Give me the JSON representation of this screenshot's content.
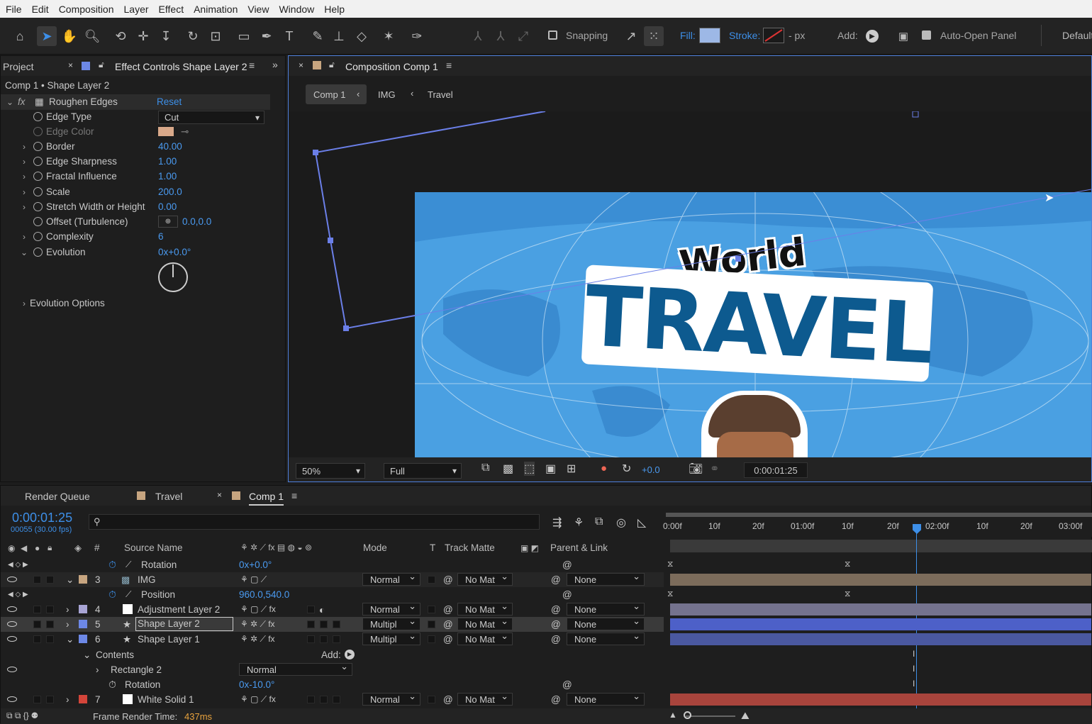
{
  "menu": [
    "File",
    "Edit",
    "Composition",
    "Layer",
    "Effect",
    "Animation",
    "View",
    "Window",
    "Help"
  ],
  "toolbar": {
    "snapping": "Snapping",
    "fill": "Fill:",
    "stroke": "Stroke:",
    "stroke_px": "- px",
    "add": "Add:",
    "auto_open": "Auto-Open Panel",
    "workspace": "Default"
  },
  "project_panel": {
    "project_tab": "Project",
    "effect_tab": "Effect Controls Shape Layer 2",
    "breadcrumb": "Comp 1 • Shape Layer 2",
    "effect_name": "Roughen Edges",
    "reset": "Reset",
    "props": [
      {
        "name": "Edge Type",
        "value": "Cut"
      },
      {
        "name": "Edge Color",
        "value": ""
      },
      {
        "name": "Border",
        "value": "40.00"
      },
      {
        "name": "Edge Sharpness",
        "value": "1.00"
      },
      {
        "name": "Fractal Influence",
        "value": "1.00"
      },
      {
        "name": "Scale",
        "value": "200.0"
      },
      {
        "name": "Stretch Width or Height",
        "value": "0.00"
      },
      {
        "name": "Offset (Turbulence)",
        "value": "0.0,0.0"
      },
      {
        "name": "Complexity",
        "value": "6"
      },
      {
        "name": "Evolution",
        "value": "0x+0.0°"
      }
    ],
    "evolution_options": "Evolution Options",
    "edge_color": "#d9a98a"
  },
  "comp_panel": {
    "tab": "Composition Comp 1",
    "crumbs": [
      "Comp 1",
      "IMG",
      "Travel"
    ],
    "zoom": "50%",
    "resolution": "Full",
    "exposure": "+0.0",
    "timecode": "0:00:01:25",
    "title_top": "World",
    "title_main": "TRAVEL"
  },
  "timeline": {
    "tabs": [
      "Render Queue",
      "Travel",
      "Comp 1"
    ],
    "timecode": "0:00:01:25",
    "fps": "00055 (30.00 fps)",
    "search_placeholder": "",
    "headers": {
      "source": "Source Name",
      "mode": "Mode",
      "t": "T",
      "matte": "Track Matte",
      "parent": "Parent & Link",
      "num": "#"
    },
    "ruler": [
      "0:00f",
      "10f",
      "20f",
      "01:00f",
      "10f",
      "20f",
      "02:00f",
      "10f",
      "20f",
      "03:00f"
    ],
    "rows": {
      "rot_name": "Rotation",
      "rot_val": "0x+0.0°",
      "img_num": "3",
      "img_name": "IMG",
      "img_mode": "Normal",
      "img_matte": "No Mat",
      "img_parent": "None",
      "pos_name": "Position",
      "pos_val": "960.0,540.0",
      "adj_num": "4",
      "adj_name": "Adjustment Layer 2",
      "adj_mode": "Normal",
      "adj_matte": "No Mat",
      "adj_parent": "None",
      "sl2_num": "5",
      "sl2_name": "Shape Layer 2",
      "sl2_mode": "Multipl",
      "sl2_matte": "No Mat",
      "sl2_parent": "None",
      "sl1_num": "6",
      "sl1_name": "Shape Layer 1",
      "sl1_mode": "Multipl",
      "sl1_matte": "No Mat",
      "sl1_parent": "None",
      "contents": "Contents",
      "add": "Add:",
      "rect_name": "Rectangle 2",
      "rect_mode": "Normal",
      "rot2_name": "Rotation",
      "rot2_val": "0x-10.0°",
      "ws_num": "7",
      "ws_name": "White Solid 1",
      "ws_mode": "Normal",
      "ws_matte": "No Mat",
      "ws_parent": "None"
    },
    "render_time_label": "Frame Render Time:",
    "render_time": "437ms"
  }
}
